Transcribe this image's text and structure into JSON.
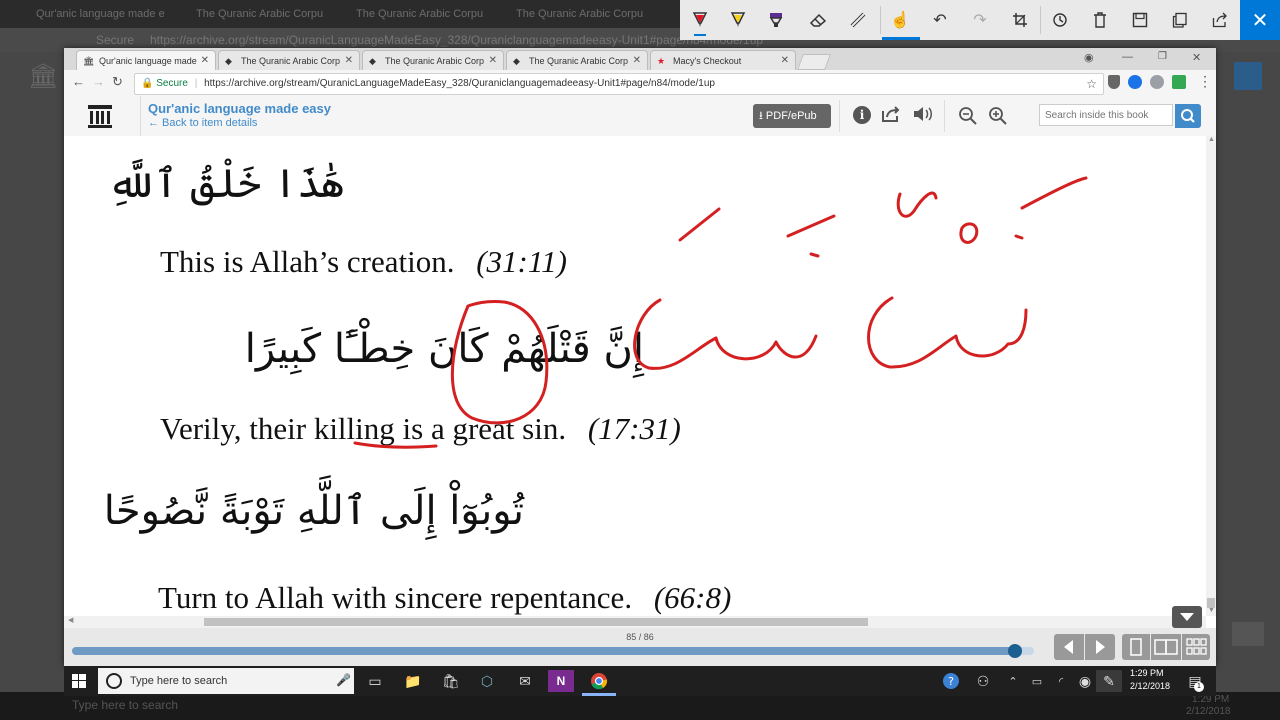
{
  "background": {
    "tabs": [
      "Qur'anic language made e",
      "The Quranic Arabic Corpu",
      "The Quranic Arabic Corpu",
      "The Quranic Arabic Corpu"
    ],
    "secure": "Secure",
    "url": "https://archive.org/stream/QuranicLanguageMadeEasy_328/Quraniclanguagemadeeasy-Unit1#page/n84/mode/1up",
    "search": "Type here to search",
    "clock_time": "1:29 PM",
    "clock_date": "2/12/2018"
  },
  "ink_toolbar": {
    "icons": [
      "ballpoint-pen-icon",
      "pencil-icon",
      "highlighter-icon",
      "eraser-icon",
      "ruler-icon",
      "touch-writing-icon",
      "undo-icon",
      "redo-icon",
      "crop-icon",
      "history-icon",
      "delete-icon",
      "save-icon",
      "copy-icon",
      "share-icon",
      "close-icon"
    ],
    "pen_colors": {
      "red": "#e81123",
      "yellow": "#f7d117",
      "purple": "#5b2d90"
    }
  },
  "browser": {
    "tabs": [
      {
        "label": "Qur'anic language made",
        "active": true
      },
      {
        "label": "The Quranic Arabic Corp",
        "active": false
      },
      {
        "label": "The Quranic Arabic Corp",
        "active": false
      },
      {
        "label": "The Quranic Arabic Corp",
        "active": false
      },
      {
        "label": "Macy's Checkout",
        "active": false
      }
    ],
    "secure_label": "Secure",
    "url": "https://archive.org/stream/QuranicLanguageMadeEasy_328/Quraniclanguagemadeeasy-Unit1#page/n84/mode/1up"
  },
  "archive": {
    "title": "Qur'anic language made easy",
    "back_link": "← Back to item details",
    "download_button": "PDF/ePub",
    "search_placeholder": "Search inside this book",
    "page_indicator": "85 / 86",
    "progress": 0.98
  },
  "book": {
    "line1_ar": "هَٰذَا خَلْقُ ٱللَّهِ",
    "line1_en": "This is Allah’s creation.",
    "line1_ref": "(31:11)",
    "line2_ar": "إِنَّ قَتْلَهُمْ كَانَ خِطْـًٔا كَبِيرًا",
    "line2_en_pre": "Verily, their ",
    "line2_en_key": "killing",
    "line2_en_post": " is a great sin.",
    "line2_ref": "(17:31)",
    "line3_ar": "تُوبُوٓاْ إِلَى ٱللَّهِ تَوْبَةً نَّصُوحًا",
    "line3_en": "Turn to Allah with sincere repentance.",
    "line3_ref": "(66:8)"
  },
  "annotation_color": "#d42020",
  "taskbar": {
    "search_placeholder": "Type here to search",
    "time": "1:29 PM",
    "date": "2/12/2018",
    "notification_count": "1"
  }
}
